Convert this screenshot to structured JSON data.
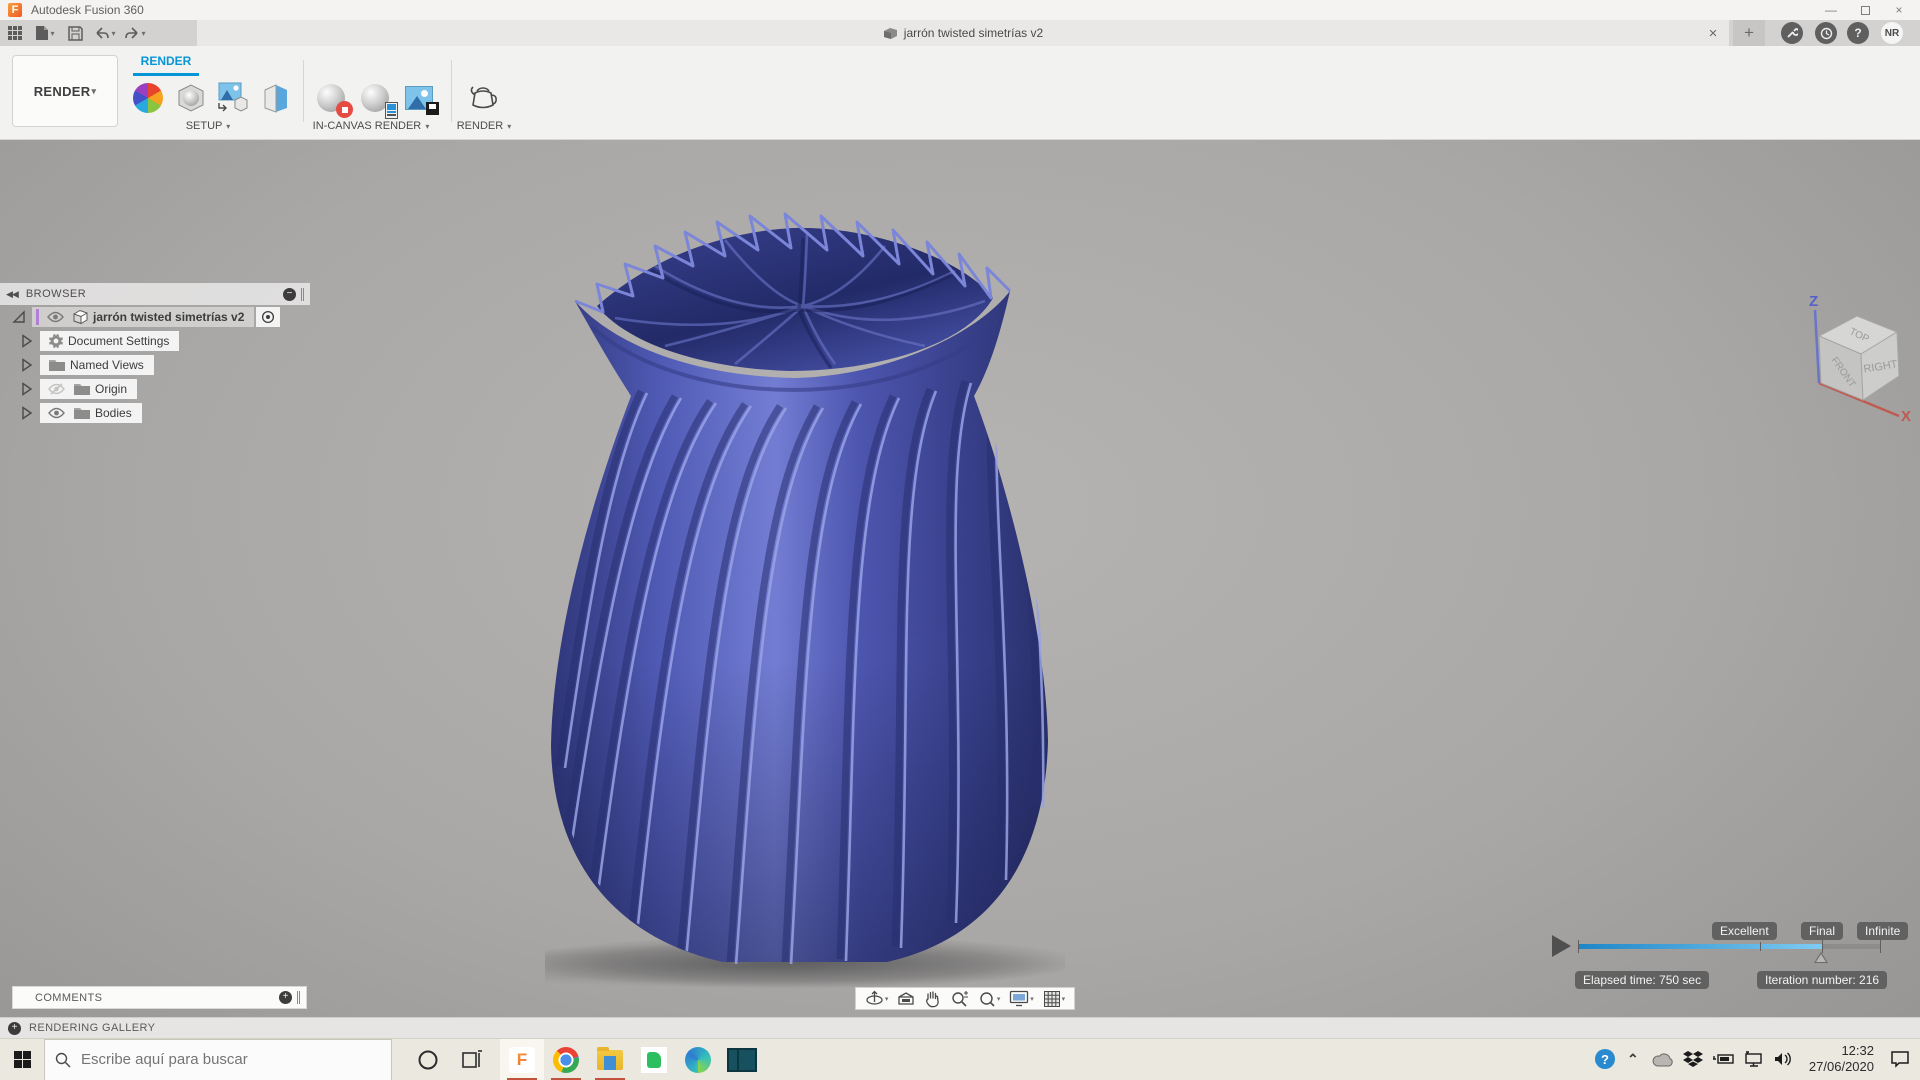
{
  "window": {
    "title": "Autodesk Fusion 360"
  },
  "tab_bar": {
    "document_title": "jarrón twisted simetrías v2",
    "avatar_initials": "NR"
  },
  "ribbon": {
    "workspace_button": "RENDER",
    "active_tab": "RENDER",
    "group_setup": "SETUP",
    "group_in_canvas": "IN-CANVAS RENDER",
    "group_render": "RENDER"
  },
  "browser": {
    "header": "BROWSER",
    "root_label": "jarrón twisted simetrías v2",
    "items": [
      {
        "label": "Document Settings"
      },
      {
        "label": "Named Views"
      },
      {
        "label": "Origin"
      },
      {
        "label": "Bodies"
      }
    ]
  },
  "viewcube": {
    "top": "TOP",
    "front": "FRONT",
    "right": "RIGHT",
    "z_axis": "Z",
    "x_axis": "X"
  },
  "render_progress": {
    "quality_labels": [
      "Excellent",
      "Final",
      "Infinite"
    ],
    "elapsed_label": "Elapsed time: 750 sec",
    "iteration_label": "Iteration number: 216"
  },
  "comments": {
    "label": "COMMENTS"
  },
  "status_bar": {
    "label": "RENDERING GALLERY"
  },
  "taskbar": {
    "search_placeholder": "Escribe aquí para buscar",
    "time": "12:32",
    "date": "27/06/2020"
  },
  "icons": {
    "caret_down": "▾",
    "collapse_panel": "◀◀",
    "close": "×",
    "plus": "+",
    "minus": "−",
    "minimize": "—",
    "question": "?",
    "chevron_up": "⌃"
  },
  "colors": {
    "accent_blue": "#0696d7",
    "vase_blue": "#4a55b0",
    "progress_blue": "#2a9fd8",
    "running_indicator": "#c0533a"
  }
}
